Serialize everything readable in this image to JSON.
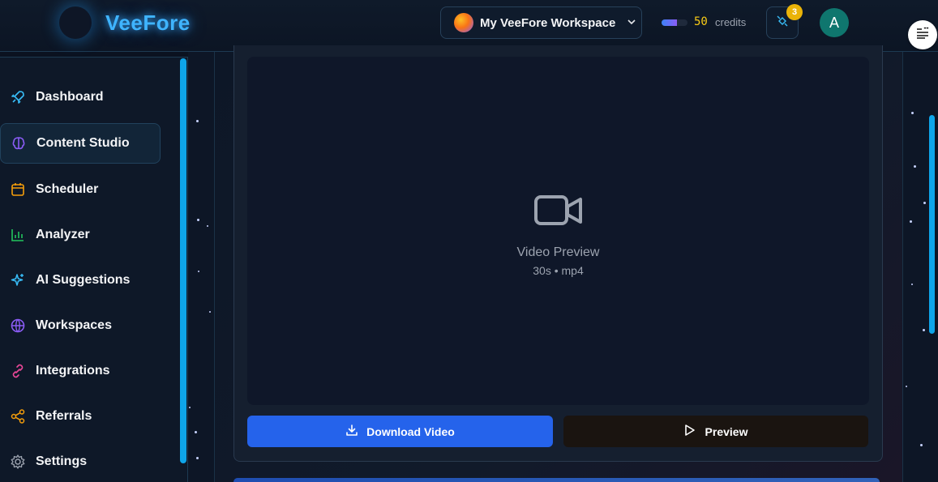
{
  "header": {
    "brand": "VeeFore",
    "workspace_name": "My VeeFore Workspace",
    "credits_value": "50",
    "credits_label": "credits",
    "credits_fill_fraction": 0.6,
    "notification_count": "3",
    "user_initial": "A"
  },
  "sidebar": {
    "items": [
      {
        "label": "Dashboard",
        "icon": "rocket-icon",
        "color": "#38bdf8",
        "active": false
      },
      {
        "label": "Content Studio",
        "icon": "brain-icon",
        "color": "#8b5cf6",
        "active": true
      },
      {
        "label": "Scheduler",
        "icon": "calendar-icon",
        "color": "#f59e0b",
        "active": false
      },
      {
        "label": "Analyzer",
        "icon": "bar-chart-icon",
        "color": "#22c55e",
        "active": false
      },
      {
        "label": "AI Suggestions",
        "icon": "sparkles-icon",
        "color": "#38bdf8",
        "active": false
      },
      {
        "label": "Workspaces",
        "icon": "globe-icon",
        "color": "#8b5cf6",
        "active": false
      },
      {
        "label": "Integrations",
        "icon": "link-icon",
        "color": "#ec4899",
        "active": false
      },
      {
        "label": "Referrals",
        "icon": "share-icon",
        "color": "#f59e0b",
        "active": false
      },
      {
        "label": "Settings",
        "icon": "gear-icon",
        "color": "#9ca3af",
        "active": false
      }
    ]
  },
  "video": {
    "title": "Video Preview",
    "meta": "30s • mp4"
  },
  "actions": {
    "download_label": "Download Video",
    "preview_label": "Preview"
  },
  "colors": {
    "accent": "#2563eb",
    "brand_glow": "#3fb4ff"
  }
}
